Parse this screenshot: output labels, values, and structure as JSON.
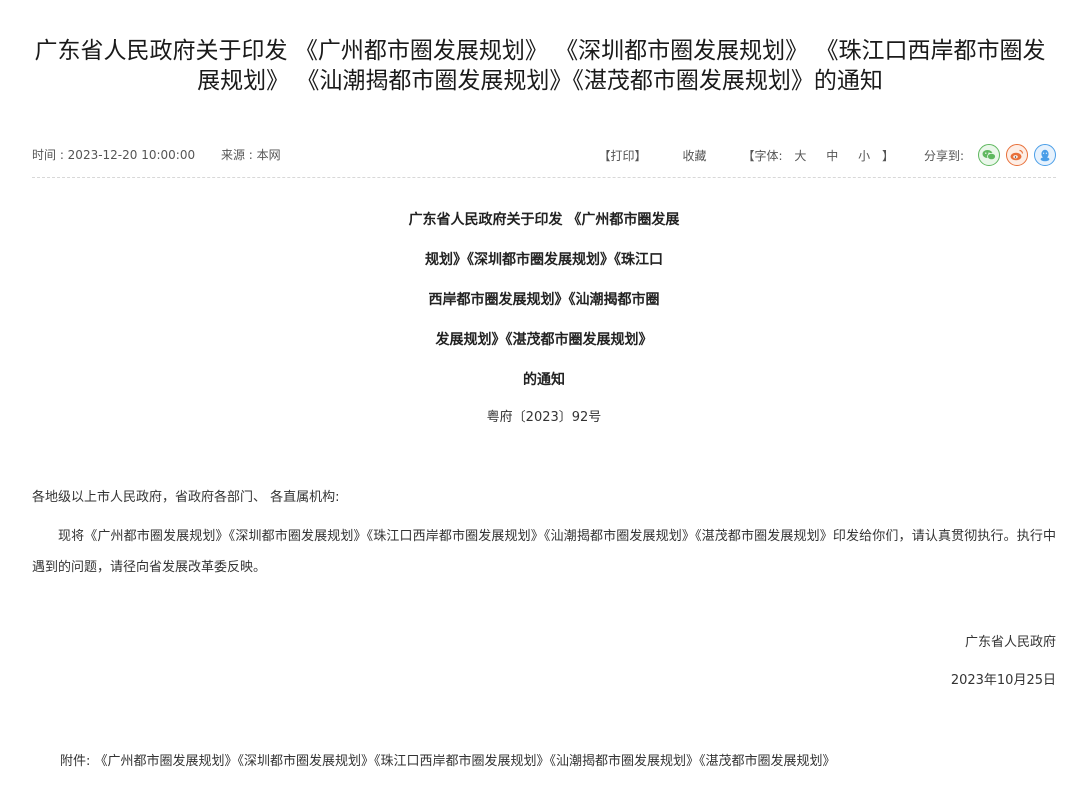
{
  "article": {
    "title": "广东省人民政府关于印发 《广州都市圈发展规划》 《深圳都市圈发展规划》 《珠江口西岸都市圈发展规划》 《汕潮揭都市圈发展规划》《湛茂都市圈发展规划》的通知",
    "meta": {
      "time": "时间 : 2023-12-20 10:00:00",
      "source": "来源 : 本网",
      "print_label": "【打印】",
      "favorite_label": "收藏",
      "font_prefix": "【字体:",
      "font_large": "大",
      "font_medium": "中",
      "font_small": "小",
      "font_suffix": "】",
      "share_label": "分享到:",
      "share_icons": [
        "wechat-icon",
        "weibo-icon",
        "qq-icon"
      ]
    },
    "doc_heading_lines": [
      "广东省人民政府关于印发 《广州都市圈发展",
      "规划》《深圳都市圈发展规划》《珠江口",
      "西岸都市圈发展规划》《汕潮揭都市圈",
      "发展规划》《湛茂都市圈发展规划》",
      "的通知"
    ],
    "doc_number": "粤府〔2023〕92号",
    "salutation": "各地级以上市人民政府，省政府各部门、 各直属机构:",
    "body": "现将《广州都市圈发展规划》《深圳都市圈发展规划》《珠江口西岸都市圈发展规划》《汕潮揭都市圈发展规划》《湛茂都市圈发展规划》印发给你们，请认真贯彻执行。执行中遇到的问题，请径向省发展改革委反映。",
    "signature_org": "广东省人民政府",
    "signature_date": "2023年10月25日",
    "attachment": "附件: 《广州都市圈发展规划》《深圳都市圈发展规划》《珠江口西岸都市圈发展规划》《汕潮揭都市圈发展规划》《湛茂都市圈发展规划》",
    "colors": {
      "wechat": "#5fb85f",
      "weibo": "#e8703a",
      "qq": "#4a9ee8"
    }
  }
}
